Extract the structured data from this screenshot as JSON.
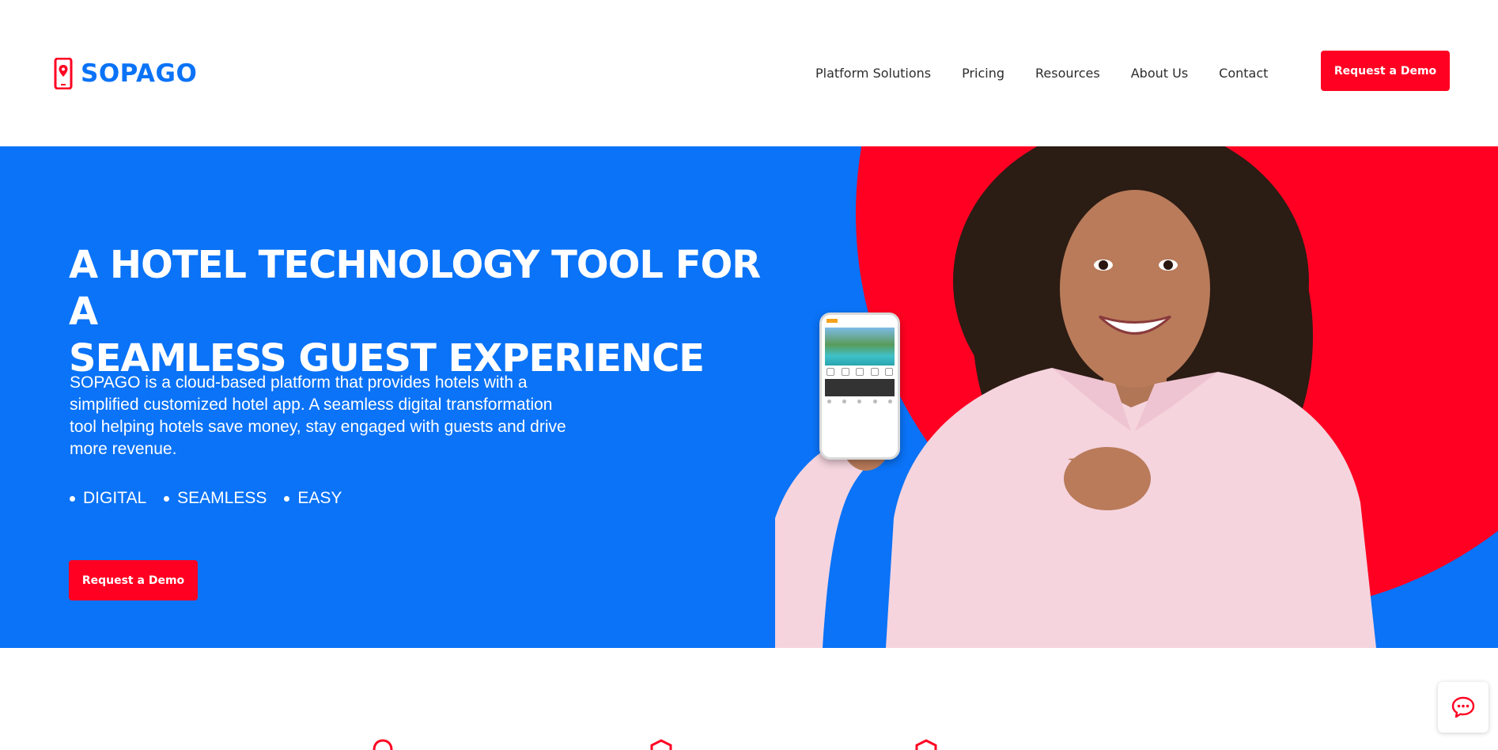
{
  "brand": {
    "name": "SOPAGO",
    "color": "#0a73f7",
    "accent": "#ff0022"
  },
  "nav": {
    "items": [
      "Platform Solutions",
      "Pricing",
      "Resources",
      "About Us",
      "Contact"
    ],
    "demo_button": "Request a Demo"
  },
  "hero": {
    "title_line1": "A HOTEL TECHNOLOGY TOOL FOR A",
    "title_line2": "SEAMLESS GUEST EXPERIENCE",
    "description": "SOPAGO is a cloud-based platform that provides hotels with a simplified customized hotel app. A seamless digital transformation tool helping hotels save money, stay engaged with guests and drive more revenue.",
    "bullets": [
      "DIGITAL",
      "SEAMLESS",
      "EASY"
    ],
    "demo_button": "Request a Demo"
  },
  "icons": {
    "logo": "phone-location-icon",
    "chat": "chat-bubble-icon",
    "features": [
      "location-pin-icon",
      "hexagon-icon",
      "hexagon-icon"
    ]
  }
}
